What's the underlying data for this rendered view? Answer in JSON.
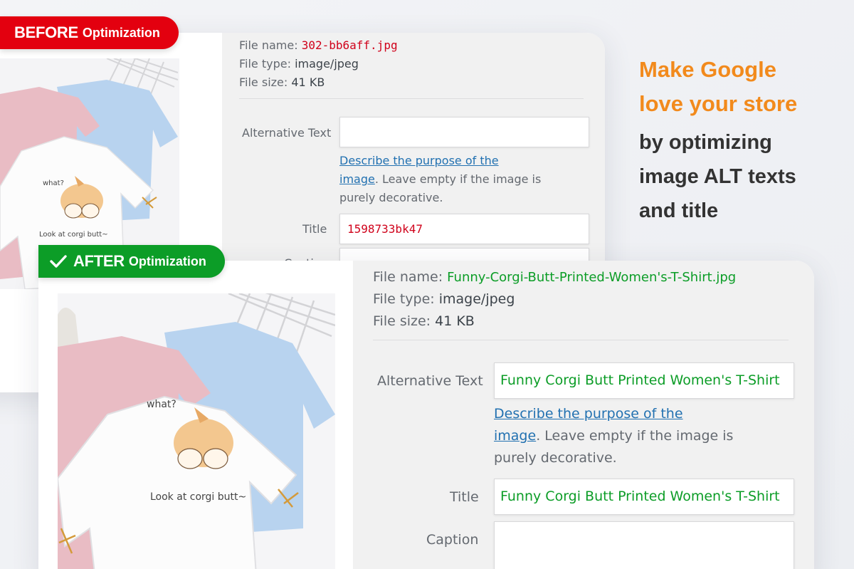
{
  "colors": {
    "before_badge": "#e3000f",
    "after_badge": "#0c9d27",
    "before_value": "#d0021b",
    "after_value": "#0c9d27",
    "headline_orange": "#f28a1c",
    "headline_dark": "#333333",
    "link": "#2271b1"
  },
  "before": {
    "badge_strong": "BEFORE",
    "badge_rest": "Optimization",
    "file_name_label": "File name:",
    "file_name": "302-bb6aff.jpg",
    "file_type_label": "File type:",
    "file_type": "image/jpeg",
    "file_size_label": "File size:",
    "file_size": "41 KB",
    "alt_label": "Alternative Text",
    "alt_value": "",
    "help_link_1": "Describe the purpose of the",
    "help_link_2": "image",
    "help_rest_1": ". Leave empty if the image is",
    "help_rest_2": "purely decorative.",
    "title_label": "Title",
    "title_value": "1598733bk47",
    "caption_label": "Caption"
  },
  "after": {
    "badge_icon": "check-icon",
    "badge_strong": "AFTER",
    "badge_rest": "Optimization",
    "file_name_label": "File name:",
    "file_name": "Funny-Corgi-Butt-Printed-Women's-T-Shirt.jpg",
    "file_type_label": "File type:",
    "file_type": "image/jpeg",
    "file_size_label": "File size:",
    "file_size": "41 KB",
    "alt_label": "Alternative Text",
    "alt_value": "Funny Corgi Butt Printed Women's T-Shirt",
    "help_link_1": "Describe the purpose of the",
    "help_link_2": "image",
    "help_rest_1": ". Leave empty if the image is",
    "help_rest_2": "purely decorative.",
    "title_label": "Title",
    "title_value": "Funny Corgi Butt Printed Women's T-Shirt",
    "caption_label": "Caption",
    "caption_value": ""
  },
  "headline": {
    "line1": "Make Google",
    "line2": "love your store",
    "line3": "by optimizing",
    "line4": "image ALT texts",
    "line5": "and title"
  },
  "product_image": {
    "icon": "corgi-tshirt-photo",
    "print_text_1": "what?",
    "print_text_2": "Look at corgi butt~"
  }
}
